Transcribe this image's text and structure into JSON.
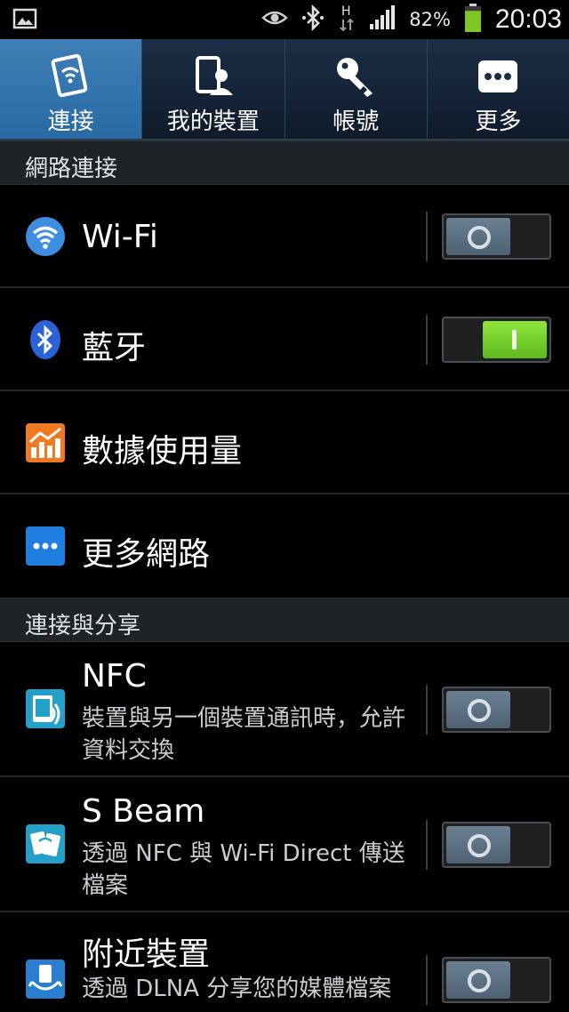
{
  "status_bar": {
    "icons": [
      "picture-icon",
      "eye-icon",
      "bluetooth-icon",
      "hsdpa-icon",
      "signal-icon",
      "battery-icon"
    ],
    "network_type": "H",
    "battery_percent": "82%",
    "battery_level": 0.82,
    "time": "20:03"
  },
  "tabs": [
    {
      "label": "連接",
      "icon": "connections-icon",
      "active": true
    },
    {
      "label": "我的裝置",
      "icon": "my-device-icon",
      "active": false
    },
    {
      "label": "帳號",
      "icon": "key-icon",
      "active": false
    },
    {
      "label": "更多",
      "icon": "more-icon",
      "active": false
    }
  ],
  "sections": {
    "network": "網路連接",
    "connect_share": "連接與分享"
  },
  "rows": {
    "wifi": {
      "title": "Wi-Fi",
      "icon": "wifi-icon",
      "toggle": "off"
    },
    "bluetooth": {
      "title": "藍牙",
      "icon": "bluetooth-icon",
      "toggle": "on"
    },
    "data_usage": {
      "title": "數據使用量",
      "icon": "data-usage-icon"
    },
    "more_networks": {
      "title": "更多網路",
      "icon": "more-networks-icon"
    },
    "nfc": {
      "title": "NFC",
      "subtitle": "裝置與另一個裝置通訊時，允許資料交換",
      "icon": "nfc-icon",
      "toggle": "off"
    },
    "sbeam": {
      "title": "S Beam",
      "subtitle": "透過 NFC 與 Wi-Fi Direct 傳送檔案",
      "icon": "sbeam-icon",
      "toggle": "off"
    },
    "nearby": {
      "title": "附近裝置",
      "subtitle": "透過 DLNA 分享您的媒體檔案",
      "icon": "nearby-devices-icon",
      "toggle": "off"
    }
  },
  "colors": {
    "active_tab": "#2f70a9",
    "toggle_on": "#74cf2c",
    "toggle_off": "#5a6d80",
    "battery": "#7ec623"
  }
}
